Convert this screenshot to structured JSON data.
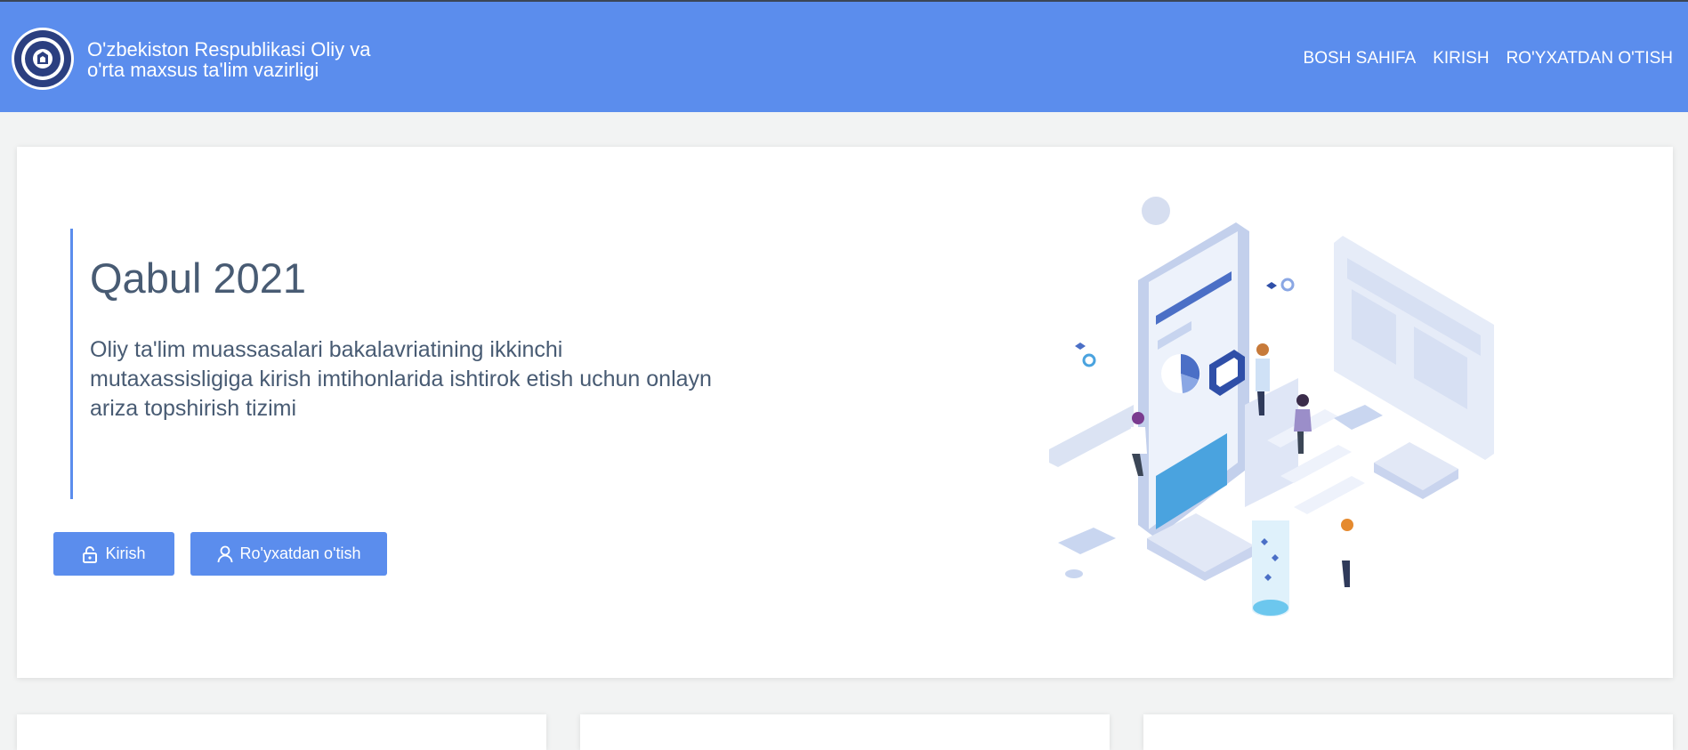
{
  "header": {
    "brand_line1": "O'zbekiston Respublikasi Oliy va",
    "brand_line2": "o'rta maxsus ta'lim vazirligi",
    "nav": [
      {
        "label": "BOSH SAHIFA"
      },
      {
        "label": "KIRISH"
      },
      {
        "label": "RO'YXATDAN O'TISH"
      }
    ]
  },
  "hero": {
    "title": "Qabul 2021",
    "description_lines": [
      "Oliy ta'lim muassasalari bakalavriatining ikkinchi",
      "mutaxassisligiga kirish imtihonlarida ishtirok etish uchun onlayn",
      "ariza topshirish tizimi"
    ],
    "login_button": "Kirish",
    "register_button": "Ro'yxatdan o'tish"
  },
  "icons": {
    "logo": "ministry-emblem-icon",
    "login": "lock-icon",
    "register": "user-icon"
  },
  "colors": {
    "primary": "#5b8ded",
    "text": "#485b73",
    "background": "#f2f3f3"
  }
}
